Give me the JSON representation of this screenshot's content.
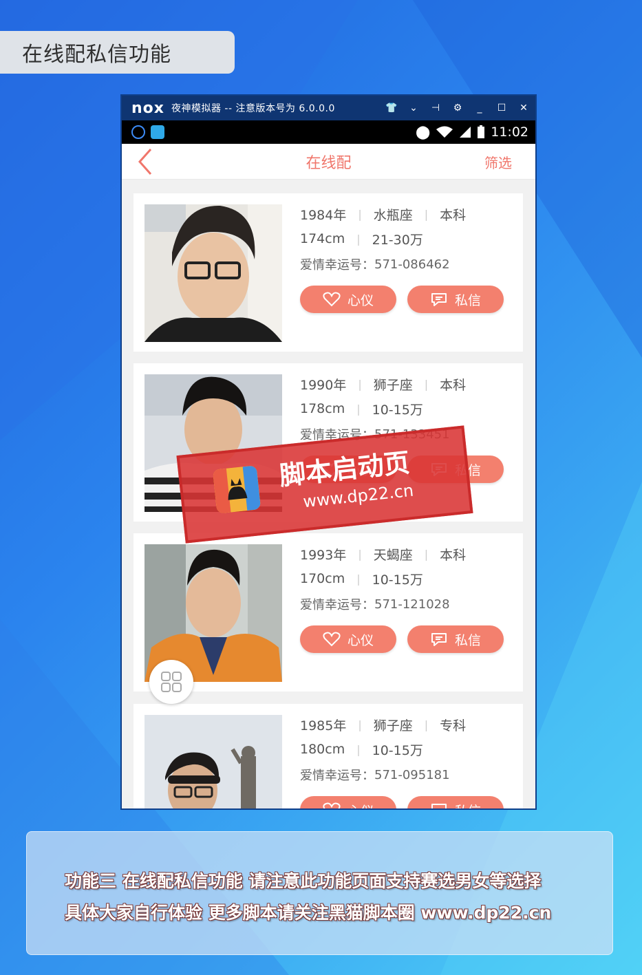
{
  "page_label": "在线配私信功能",
  "emulator": {
    "logo": "nox",
    "title": "夜神模拟器 -- 注意版本号为 6.0.0.0",
    "controls": [
      "shirt-icon",
      "chevron-down-icon",
      "pin-icon",
      "gear-icon",
      "minimize-icon",
      "maximize-icon",
      "close-icon"
    ]
  },
  "status_bar": {
    "time": "11:02"
  },
  "app": {
    "title": "在线配",
    "filter_label": "筛选",
    "like_label": "心仪",
    "message_label": "私信",
    "lucky_prefix": "爱情幸运号：",
    "profiles": [
      {
        "year": "1984年",
        "sign": "水瓶座",
        "edu": "本科",
        "height": "174cm",
        "income": "21-30万",
        "lucky": "571-086462"
      },
      {
        "year": "1990年",
        "sign": "狮子座",
        "edu": "本科",
        "height": "178cm",
        "income": "10-15万",
        "lucky": "571-133451"
      },
      {
        "year": "1993年",
        "sign": "天蝎座",
        "edu": "本科",
        "height": "170cm",
        "income": "10-15万",
        "lucky": "571-121028"
      },
      {
        "year": "1985年",
        "sign": "狮子座",
        "edu": "专科",
        "height": "180cm",
        "income": "10-15万",
        "lucky": "571-095181"
      }
    ]
  },
  "watermark": {
    "title": "脚本启动页",
    "url": "www.dp22.cn"
  },
  "caption": {
    "line1": "功能三 在线配私信功能 请注意此功能页面支持赛选男女等选择",
    "line2": "具体大家自行体验 更多脚本请关注黑猫脚本圈 www.dp22.cn"
  }
}
